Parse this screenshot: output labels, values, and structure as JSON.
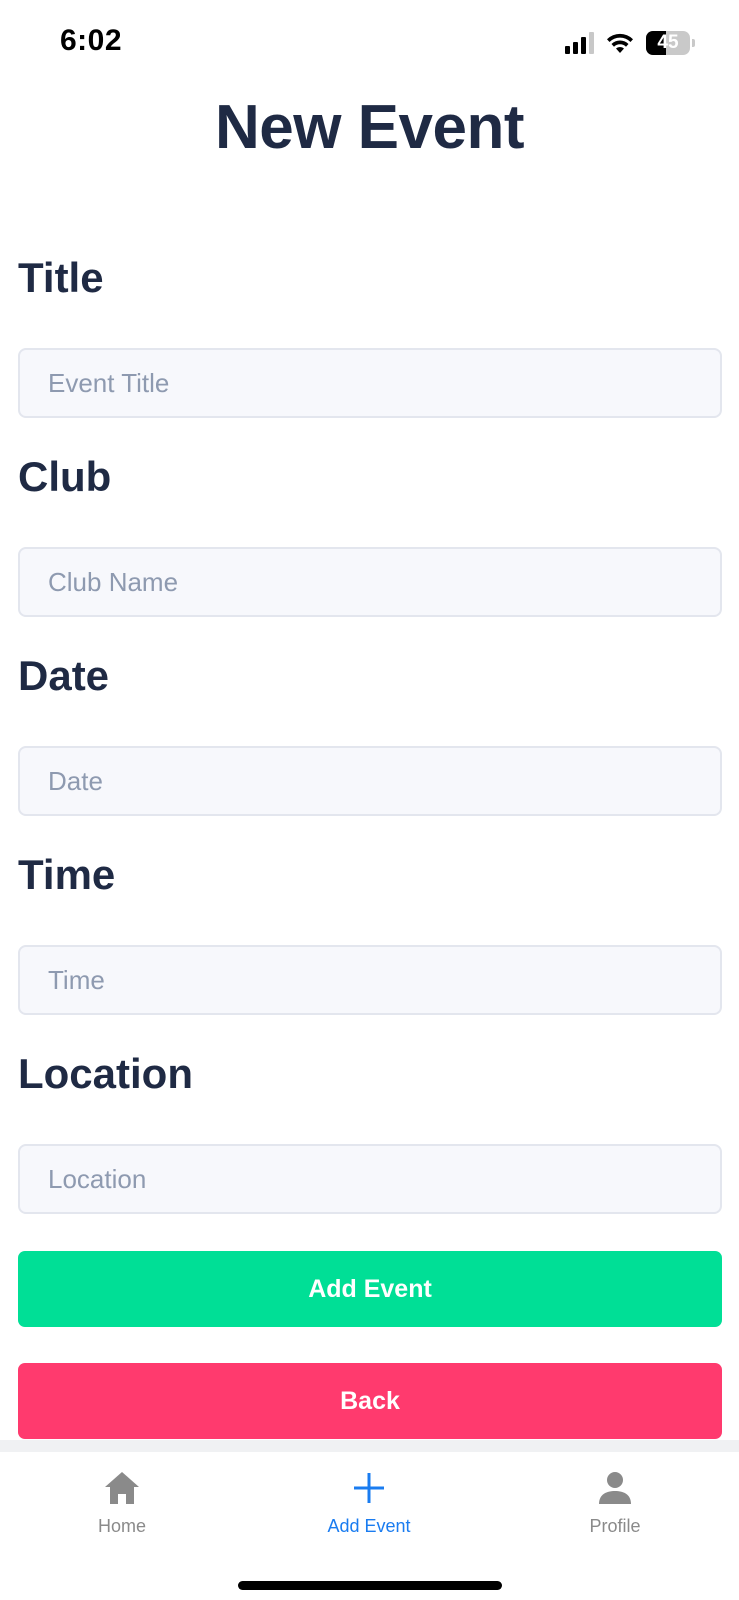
{
  "status_bar": {
    "time": "6:02",
    "battery_level": "45",
    "icons": [
      "signal-icon",
      "wifi-icon",
      "battery-icon"
    ]
  },
  "header": {
    "title": "New Event"
  },
  "form": {
    "title": {
      "label": "Title",
      "placeholder": "Event Title",
      "value": ""
    },
    "club": {
      "label": "Club",
      "placeholder": "Club Name",
      "value": ""
    },
    "date": {
      "label": "Date",
      "placeholder": "Date",
      "value": ""
    },
    "time": {
      "label": "Time",
      "placeholder": "Time",
      "value": ""
    },
    "location": {
      "label": "Location",
      "placeholder": "Location",
      "value": ""
    }
  },
  "actions": {
    "add_label": "Add Event",
    "back_label": "Back"
  },
  "tab_bar": {
    "items": [
      {
        "label": "Home",
        "icon": "home-icon",
        "active": false
      },
      {
        "label": "Add Event",
        "icon": "plus-icon",
        "active": true
      },
      {
        "label": "Profile",
        "icon": "person-icon",
        "active": false
      }
    ]
  },
  "colors": {
    "title_text": "#1f2a44",
    "add_button": "#00df96",
    "back_button": "#ff3a6e",
    "active_tab": "#1a7cf0",
    "inactive_tab": "#8a8a8a",
    "input_background": "#f7f8fc",
    "placeholder": "#8e9ab0"
  }
}
